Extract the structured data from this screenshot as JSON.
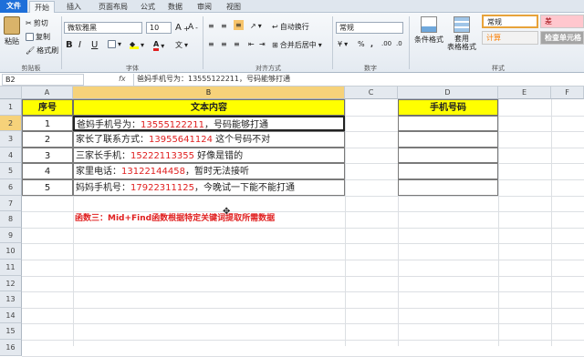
{
  "tabs": [
    "文件",
    "开始",
    "插入",
    "页面布局",
    "公式",
    "数据",
    "审阅",
    "视图"
  ],
  "ribbon": {
    "clipboard": {
      "paste": "粘贴",
      "cut": "剪切",
      "copy": "复制",
      "format_painter": "格式刷",
      "label": "剪贴板"
    },
    "font": {
      "name": "微软雅黑",
      "size": "10",
      "bold": "B",
      "italic": "I",
      "underline": "U",
      "label": "字体"
    },
    "align": {
      "wrap": "自动换行",
      "merge": "合并后居中",
      "label": "对齐方式"
    },
    "number": {
      "format": "常规",
      "pct": "%",
      "comma": ",",
      "label": "数字"
    },
    "styles": {
      "cond": "条件格式",
      "table": "套用\n表格格式",
      "normal": "常规",
      "bad": "差",
      "calc": "计算",
      "check": "检查单元格",
      "label": "样式"
    }
  },
  "formula_bar": {
    "name_box": "B2",
    "fx": "fx",
    "content": "爸妈手机号为：13555122211，号码能够打通"
  },
  "columns": [
    "A",
    "B",
    "C",
    "D",
    "E",
    "F"
  ],
  "rows": [
    "1",
    "2",
    "3",
    "4",
    "5",
    "6",
    "7",
    "8",
    "9",
    "10",
    "11",
    "12",
    "13",
    "14",
    "15",
    "16"
  ],
  "table": {
    "headers": {
      "seq": "序号",
      "text": "文本内容",
      "phone": "手机号码"
    },
    "rows": [
      {
        "seq": "1",
        "pre": "爸妈手机号为：",
        "num": "13555122211",
        "post": "，号码能够打通"
      },
      {
        "seq": "2",
        "pre": "家长了联系方式：",
        "num": "13955641124",
        "post": " 这个号码不对"
      },
      {
        "seq": "3",
        "pre": "三家长手机：",
        "num": "15222113355",
        "post": " 好像是错的"
      },
      {
        "seq": "4",
        "pre": "家里电话：",
        "num": "13122144458",
        "post": "，暂时无法接听"
      },
      {
        "seq": "5",
        "pre": "妈妈手机号：",
        "num": "17922311125",
        "post": "，今晚试一下能不能打通"
      }
    ]
  },
  "note": "函数三：Mid+Find函数根据特定关键词提取所需数据",
  "colors": {
    "header_fill": "#ffff00",
    "number_text": "#e02020",
    "note_text": "#e02020",
    "file_tab": "#1e6fd9"
  }
}
